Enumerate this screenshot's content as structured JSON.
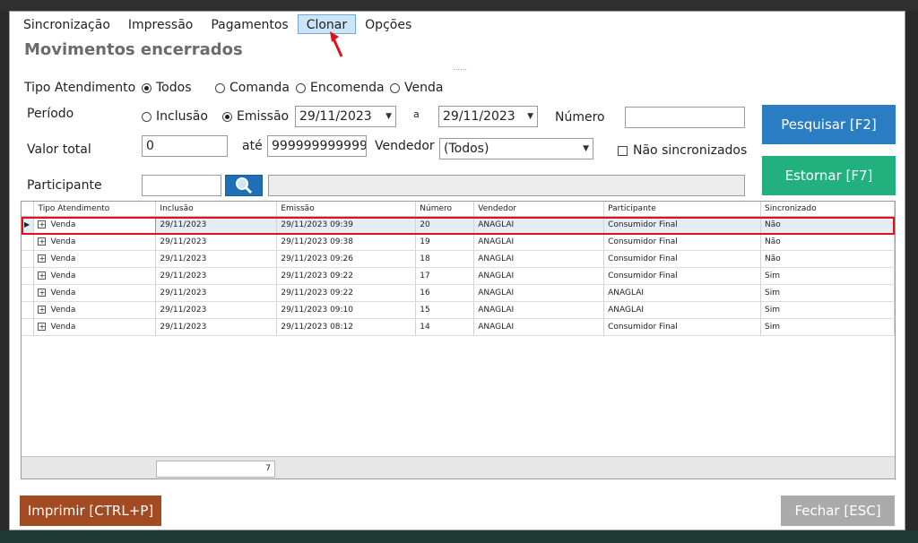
{
  "menu": {
    "items": [
      {
        "label": "Sincronização"
      },
      {
        "label": "Impressão"
      },
      {
        "label": "Pagamentos"
      },
      {
        "label": "Clonar"
      },
      {
        "label": "Opções"
      }
    ],
    "active_item": "Clonar"
  },
  "page": {
    "title": "Movimentos encerrados"
  },
  "filters": {
    "tipo_label": "Tipo Atendimento",
    "tipo_options": [
      "Todos",
      "Comanda",
      "Encomenda",
      "Venda"
    ],
    "tipo_selected": "Todos",
    "periodo_label": "Período",
    "periodo_options": [
      "Inclusão",
      "Emissão"
    ],
    "periodo_selected": "Emissão",
    "date_from": "29/11/2023",
    "date_sep": "a",
    "date_to": "29/11/2023",
    "numero_label": "Número",
    "numero_value": "",
    "valor_label": "Valor total",
    "valor_from": "0",
    "valor_ate_label": "até",
    "valor_to": "999999999999",
    "vendedor_label": "Vendedor",
    "vendedor_value": "(Todos)",
    "nao_sincronizados_label": "Não sincronizados",
    "nao_sincronizados_checked": false,
    "participante_label": "Participante",
    "participante_code": "",
    "participante_name": ""
  },
  "buttons": {
    "pesquisar": "Pesquisar [F2]",
    "estornar": "Estornar [F7]",
    "imprimir": "Imprimir [CTRL+P]",
    "fechar": "Fechar [ESC]"
  },
  "colors": {
    "pesquisar": "#2a7dc2",
    "estornar": "#23b07f",
    "imprimir": "#a24a22",
    "fechar": "#aaaaaa",
    "selection_outline": "#e0101c"
  },
  "grid": {
    "columns": [
      "Tipo Atendimento",
      "Inclusão",
      "Emissão",
      "Número",
      "Vendedor",
      "Participante",
      "Sincronizado"
    ],
    "rows": [
      {
        "tipo": "Venda",
        "inclusao": "29/11/2023",
        "emissao": "29/11/2023 09:39",
        "numero": "20",
        "vendedor": "ANAGLAI",
        "participante": "Consumidor Final",
        "sincronizado": "Não"
      },
      {
        "tipo": "Venda",
        "inclusao": "29/11/2023",
        "emissao": "29/11/2023 09:38",
        "numero": "19",
        "vendedor": "ANAGLAI",
        "participante": "Consumidor Final",
        "sincronizado": "Não"
      },
      {
        "tipo": "Venda",
        "inclusao": "29/11/2023",
        "emissao": "29/11/2023 09:26",
        "numero": "18",
        "vendedor": "ANAGLAI",
        "participante": "Consumidor Final",
        "sincronizado": "Não"
      },
      {
        "tipo": "Venda",
        "inclusao": "29/11/2023",
        "emissao": "29/11/2023 09:22",
        "numero": "17",
        "vendedor": "ANAGLAI",
        "participante": "Consumidor Final",
        "sincronizado": "Sim"
      },
      {
        "tipo": "Venda",
        "inclusao": "29/11/2023",
        "emissao": "29/11/2023 09:22",
        "numero": "16",
        "vendedor": "ANAGLAI",
        "participante": "ANAGLAI",
        "sincronizado": "Sim"
      },
      {
        "tipo": "Venda",
        "inclusao": "29/11/2023",
        "emissao": "29/11/2023 09:10",
        "numero": "15",
        "vendedor": "ANAGLAI",
        "participante": "ANAGLAI",
        "sincronizado": "Sim"
      },
      {
        "tipo": "Venda",
        "inclusao": "29/11/2023",
        "emissao": "29/11/2023 08:12",
        "numero": "14",
        "vendedor": "ANAGLAI",
        "participante": "Consumidor Final",
        "sincronizado": "Sim"
      }
    ],
    "selected_row": 0,
    "count": "7"
  }
}
